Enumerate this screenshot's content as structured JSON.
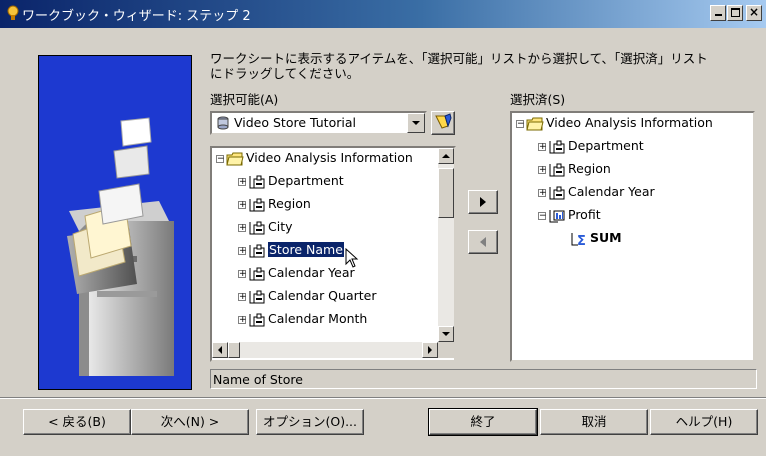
{
  "window": {
    "title": "ワークブック・ウィザード: ステップ 2"
  },
  "instructions": "ワークシートに表示するアイテムを、「選択可能」リストから選択して、「選択済」リスト\nにドラッグしてください。",
  "available": {
    "label": "選択可能(A)",
    "business_area": "Video Store Tutorial",
    "items": [
      {
        "label": "Video Analysis Information",
        "type": "folder"
      },
      {
        "label": "Department",
        "type": "item"
      },
      {
        "label": "Region",
        "type": "item"
      },
      {
        "label": "City",
        "type": "item"
      },
      {
        "label": "Store Name",
        "type": "item",
        "selected": true
      },
      {
        "label": "Calendar Year",
        "type": "item"
      },
      {
        "label": "Calendar Quarter",
        "type": "item"
      },
      {
        "label": "Calendar Month",
        "type": "item"
      }
    ]
  },
  "selected": {
    "label": "選択済(S)",
    "items": [
      {
        "label": "Video Analysis Information",
        "type": "folder"
      },
      {
        "label": "Department",
        "type": "item"
      },
      {
        "label": "Region",
        "type": "item"
      },
      {
        "label": "Calendar Year",
        "type": "item"
      },
      {
        "label": "Profit",
        "type": "measure"
      },
      {
        "label": "SUM",
        "type": "sum"
      }
    ]
  },
  "status": "Name of Store",
  "buttons": {
    "back": "< 戻る(B)",
    "next": "次へ(N) >",
    "options": "オプション(O)...",
    "finish": "終了",
    "cancel": "取消",
    "help": "ヘルプ(H)"
  },
  "colors": {
    "selection": "#0a246a",
    "art_bg": "#1d39d0"
  }
}
